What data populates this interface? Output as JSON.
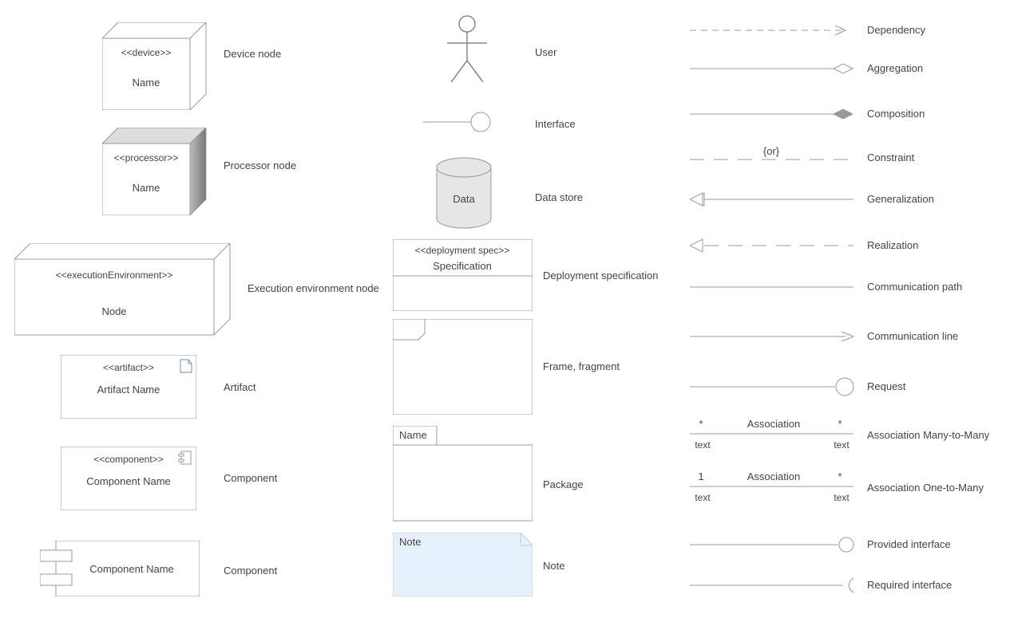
{
  "col1": [
    {
      "stereo": "<<device>>",
      "name": "Name",
      "caption": "Device node"
    },
    {
      "stereo": "<<processor>>",
      "name": "Name",
      "caption": "Processor node"
    },
    {
      "stereo": "<<executionEnvironment>>",
      "name": "Node",
      "caption": "Execution environment node"
    },
    {
      "stereo": "<<artifact>>",
      "name": "Artifact Name",
      "caption": "Artifact"
    },
    {
      "stereo": "<<component>>",
      "name": "Component Name",
      "caption": "Component"
    },
    {
      "name": "Component Name",
      "caption": "Component"
    }
  ],
  "col2": [
    {
      "caption": "User"
    },
    {
      "caption": "Interface"
    },
    {
      "name": "Data",
      "caption": "Data store"
    },
    {
      "stereo": "<<deployment spec>>",
      "name": "Specification",
      "caption": "Deployment specification"
    },
    {
      "caption": "Frame, fragment"
    },
    {
      "tab": "Name",
      "caption": "Package"
    },
    {
      "name": "Note",
      "caption": "Note"
    }
  ],
  "col3": [
    {
      "caption": "Dependency"
    },
    {
      "caption": "Aggregation"
    },
    {
      "caption": "Composition"
    },
    {
      "constraint": "{or}",
      "caption": "Constraint"
    },
    {
      "caption": "Generalization"
    },
    {
      "caption": "Realization"
    },
    {
      "caption": "Communication path"
    },
    {
      "caption": "Communication line"
    },
    {
      "caption": "Request"
    },
    {
      "left_mult": "*",
      "right_mult": "*",
      "label": "Association",
      "left_text": "text",
      "right_text": "text",
      "caption": "Association Many-to-Many"
    },
    {
      "left_mult": "1",
      "right_mult": "*",
      "label": "Association",
      "left_text": "text",
      "right_text": "text",
      "caption": "Association One-to-Many"
    },
    {
      "caption": "Provided interface"
    },
    {
      "caption": "Required interface"
    }
  ]
}
